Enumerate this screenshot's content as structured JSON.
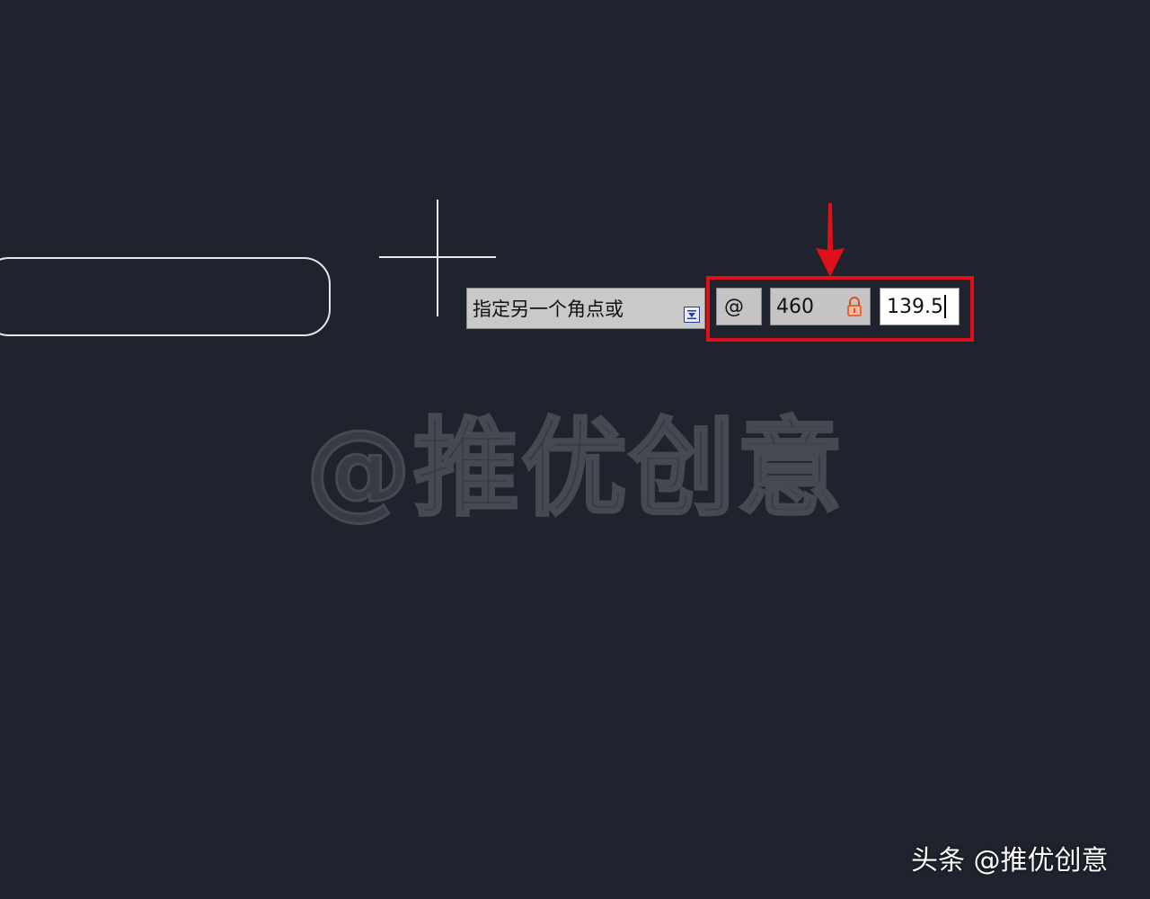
{
  "canvas": {
    "background": "#1e232d",
    "shape": "rounded-rectangle-outline",
    "cursor": "crosshair"
  },
  "dynamic_input": {
    "prompt": "指定另一个角点或",
    "expand_icon": "down-arrow-box-icon",
    "relative_prefix": "@",
    "length_value": "460",
    "length_locked": true,
    "lock_icon": "lock-icon",
    "angle_value": "139.5"
  },
  "annotation": {
    "highlight_color": "#e0101a",
    "arrow": "down-arrow-icon"
  },
  "watermark": {
    "text": "@推优创意"
  },
  "credit": {
    "text": "头条 @推优创意"
  }
}
